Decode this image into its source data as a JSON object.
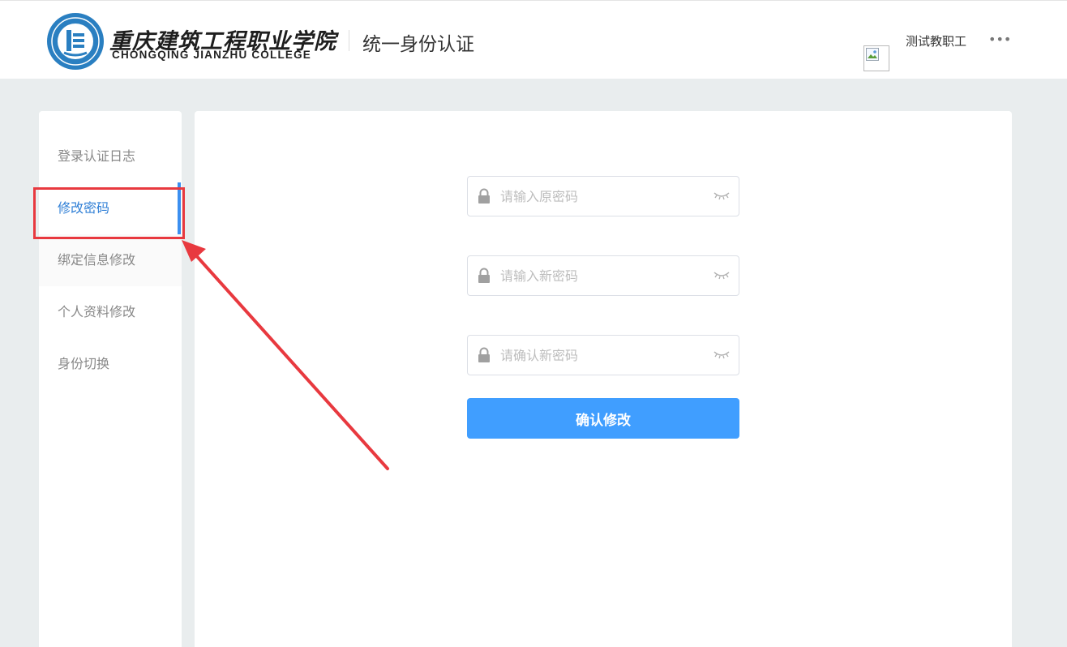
{
  "header": {
    "logo_cn": "重庆建筑工程职业学院",
    "logo_en": "CHONGQING JIANZHU COLLEGE",
    "site_title": "统一身份认证",
    "user_name": "测试教职工",
    "more_icon": "more-dots-icon",
    "avatar": "broken-image-icon"
  },
  "sidebar": {
    "items": [
      {
        "label": "登录认证日志"
      },
      {
        "label": "修改密码",
        "active": true
      },
      {
        "label": "绑定信息修改"
      },
      {
        "label": "个人资料修改"
      },
      {
        "label": "身份切换"
      }
    ]
  },
  "form": {
    "old_password_placeholder": "请输入原密码",
    "new_password_placeholder": "请输入新密码",
    "confirm_password_placeholder": "请确认新密码",
    "submit_label": "确认修改"
  },
  "colors": {
    "accent": "#409eff",
    "active_text": "#2f7fd6",
    "annotation": "#e8393f",
    "page_bg": "#e9edee"
  },
  "icons": {
    "field_left": "lock-icon",
    "field_right": "eye-closed-icon"
  }
}
